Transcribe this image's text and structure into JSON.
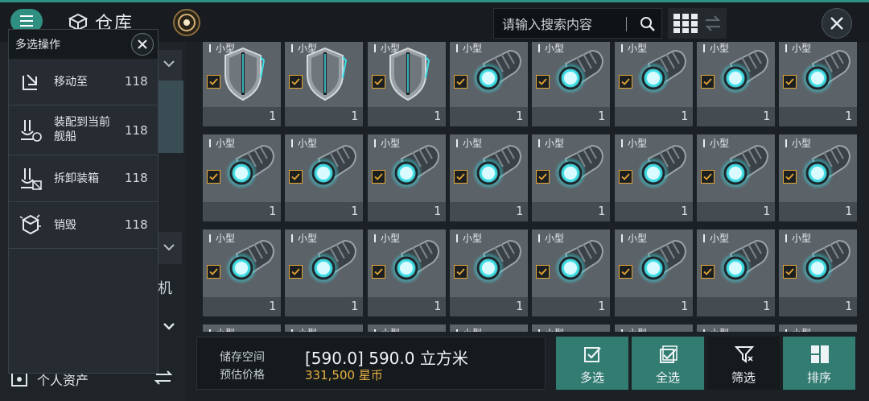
{
  "header": {
    "title": "仓库",
    "search_placeholder": "请输入搜索内容"
  },
  "popup": {
    "title": "多选操作",
    "actions": [
      {
        "label": "移动至",
        "count": "118"
      },
      {
        "label": "装配到当前舰船",
        "count": "118"
      },
      {
        "label": "拆卸装箱",
        "count": "118"
      },
      {
        "label": "销毁",
        "count": "118"
      }
    ]
  },
  "sidebar": {
    "partial_text": "机",
    "personal_assets": "个人资产"
  },
  "grid": {
    "items": [
      {
        "size": "小型",
        "qty": "1",
        "kind": "shield",
        "checked": true
      },
      {
        "size": "小型",
        "qty": "1",
        "kind": "shield",
        "checked": true
      },
      {
        "size": "小型",
        "qty": "1",
        "kind": "shield",
        "checked": true
      },
      {
        "size": "小型",
        "qty": "1",
        "kind": "cannon",
        "checked": true
      },
      {
        "size": "小型",
        "qty": "1",
        "kind": "cannon",
        "checked": true
      },
      {
        "size": "小型",
        "qty": "1",
        "kind": "cannon",
        "checked": true
      },
      {
        "size": "小型",
        "qty": "1",
        "kind": "cannon",
        "checked": true
      },
      {
        "size": "小型",
        "qty": "1",
        "kind": "cannon",
        "checked": true
      },
      {
        "size": "小型",
        "qty": "1",
        "kind": "cannon",
        "checked": true
      },
      {
        "size": "小型",
        "qty": "1",
        "kind": "cannon",
        "checked": true
      },
      {
        "size": "小型",
        "qty": "1",
        "kind": "cannon",
        "checked": true
      },
      {
        "size": "小型",
        "qty": "1",
        "kind": "cannon",
        "checked": true
      },
      {
        "size": "小型",
        "qty": "1",
        "kind": "cannon",
        "checked": true
      },
      {
        "size": "小型",
        "qty": "1",
        "kind": "cannon",
        "checked": true
      },
      {
        "size": "小型",
        "qty": "1",
        "kind": "cannon",
        "checked": true
      },
      {
        "size": "小型",
        "qty": "1",
        "kind": "cannon",
        "checked": true
      },
      {
        "size": "小型",
        "qty": "1",
        "kind": "cannon",
        "checked": true
      },
      {
        "size": "小型",
        "qty": "1",
        "kind": "cannon",
        "checked": true
      },
      {
        "size": "小型",
        "qty": "1",
        "kind": "cannon",
        "checked": true
      },
      {
        "size": "小型",
        "qty": "1",
        "kind": "cannon",
        "checked": true
      },
      {
        "size": "小型",
        "qty": "1",
        "kind": "cannon",
        "checked": true
      },
      {
        "size": "小型",
        "qty": "1",
        "kind": "cannon",
        "checked": true
      },
      {
        "size": "小型",
        "qty": "1",
        "kind": "cannon",
        "checked": true
      },
      {
        "size": "小型",
        "qty": "1",
        "kind": "cannon",
        "checked": true
      },
      {
        "size": "小型",
        "qty": "",
        "kind": "partial",
        "checked": false
      },
      {
        "size": "小型",
        "qty": "",
        "kind": "partial",
        "checked": false
      },
      {
        "size": "小型",
        "qty": "",
        "kind": "partial",
        "checked": false
      },
      {
        "size": "小型",
        "qty": "",
        "kind": "partial",
        "checked": false
      },
      {
        "size": "小型",
        "qty": "",
        "kind": "partial",
        "checked": false
      },
      {
        "size": "小型",
        "qty": "",
        "kind": "partial",
        "checked": false
      },
      {
        "size": "小型",
        "qty": "",
        "kind": "partial",
        "checked": false
      },
      {
        "size": "小型",
        "qty": "",
        "kind": "partial",
        "checked": false
      }
    ]
  },
  "footer": {
    "storage_label": "储存空间",
    "price_label": "预估价格",
    "storage_value": "[590.0] 590.0 立方米",
    "price_value": "331,500 星币",
    "buttons": [
      {
        "label": "多选",
        "style": "teal"
      },
      {
        "label": "全选",
        "style": "teal"
      },
      {
        "label": "筛选",
        "style": "dark"
      },
      {
        "label": "排序",
        "style": "teal"
      }
    ]
  },
  "colors": {
    "accent_teal": "#327c72",
    "check_gold": "#e4a632",
    "price_gold": "#e8b142",
    "glow_cyan": "#3fe0e8"
  }
}
